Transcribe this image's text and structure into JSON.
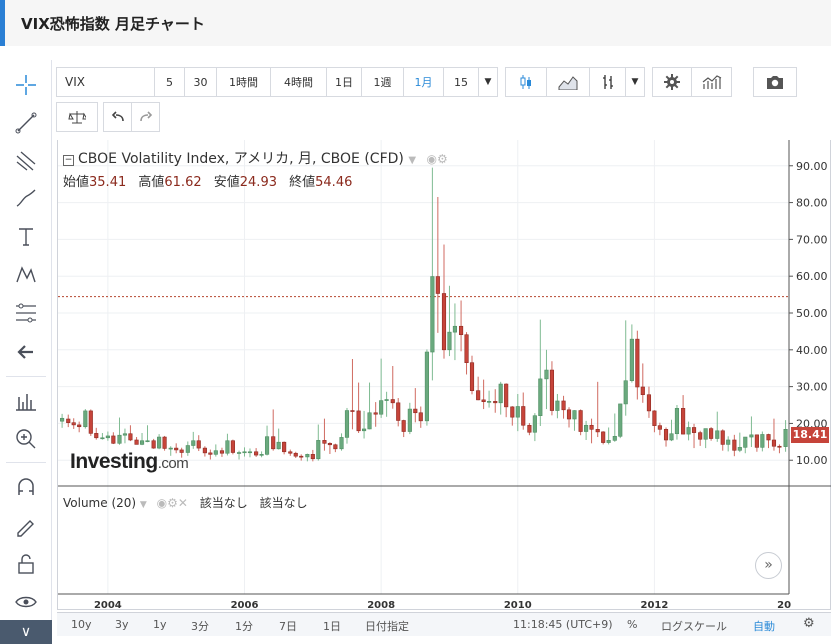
{
  "title": "VIX恐怖指数 月足チャート",
  "toolbar": {
    "symbol": "VIX",
    "intervals": [
      "5",
      "30",
      "1時間",
      "4時間",
      "1日",
      "1週",
      "1月",
      "15"
    ],
    "active_interval": "1月"
  },
  "legend": {
    "name": "CBOE Volatility Index, アメリカ, 月, CBOE (CFD)",
    "open_label": "始値",
    "open": "35.41",
    "high_label": "高値",
    "high": "61.62",
    "low_label": "安値",
    "low": "24.93",
    "close_label": "終値",
    "close": "54.46"
  },
  "watermark": {
    "brand": "Investing",
    "suffix": ".com"
  },
  "volume": {
    "label": "Volume (20)",
    "na1": "該当なし",
    "na2": "該当なし"
  },
  "last_price": "18.41",
  "bottom_bar": {
    "ranges": [
      "10y",
      "3y",
      "1y",
      "3分",
      "1分",
      "7日",
      "1日",
      "日付指定"
    ],
    "time": "11:18:45 (UTC+9)",
    "percent": "%",
    "log": "ログスケール",
    "auto": "自動"
  },
  "colors": {
    "up": "#6aa97e",
    "down": "#c6443a",
    "accent": "#2a8ad8"
  },
  "chart_data": {
    "type": "candlestick",
    "y_ticks": [
      "10.00",
      "20.00",
      "30.00",
      "40.00",
      "50.00",
      "60.00",
      "70.00",
      "80.00",
      "90.00"
    ],
    "x_ticks": [
      "2004",
      "2006",
      "2008",
      "2010",
      "2012",
      "20"
    ],
    "ylim": [
      3,
      97
    ],
    "xlim": [
      2003.27,
      2013.97
    ],
    "hline": 54.46,
    "grid": true,
    "candles": [
      {
        "x": 2003.33,
        "o": 20.6,
        "h": 22.6,
        "l": 18.8,
        "c": 21.4
      },
      {
        "x": 2003.42,
        "o": 21.2,
        "h": 22.4,
        "l": 19.0,
        "c": 20.2
      },
      {
        "x": 2003.5,
        "o": 20.2,
        "h": 21.4,
        "l": 18.5,
        "c": 19.6
      },
      {
        "x": 2003.58,
        "o": 19.6,
        "h": 20.5,
        "l": 17.6,
        "c": 19.1
      },
      {
        "x": 2003.67,
        "o": 19.1,
        "h": 23.9,
        "l": 18.6,
        "c": 23.4
      },
      {
        "x": 2003.75,
        "o": 23.4,
        "h": 23.8,
        "l": 16.6,
        "c": 17.3
      },
      {
        "x": 2003.83,
        "o": 17.3,
        "h": 18.8,
        "l": 15.6,
        "c": 16.1
      },
      {
        "x": 2003.92,
        "o": 16.1,
        "h": 17.4,
        "l": 15.6,
        "c": 16.1
      },
      {
        "x": 2004.0,
        "o": 16.1,
        "h": 17.8,
        "l": 15.3,
        "c": 16.6
      },
      {
        "x": 2004.08,
        "o": 16.6,
        "h": 17.6,
        "l": 14.4,
        "c": 14.6
      },
      {
        "x": 2004.17,
        "o": 14.6,
        "h": 21.6,
        "l": 14.2,
        "c": 16.8
      },
      {
        "x": 2004.25,
        "o": 16.8,
        "h": 18.6,
        "l": 14.6,
        "c": 17.2
      },
      {
        "x": 2004.33,
        "o": 17.2,
        "h": 19.5,
        "l": 15.2,
        "c": 15.5
      },
      {
        "x": 2004.42,
        "o": 15.5,
        "h": 16.3,
        "l": 14.3,
        "c": 14.3
      },
      {
        "x": 2004.5,
        "o": 14.3,
        "h": 17.4,
        "l": 14.1,
        "c": 15.3
      },
      {
        "x": 2004.58,
        "o": 15.3,
        "h": 19.5,
        "l": 14.9,
        "c": 15.3
      },
      {
        "x": 2004.67,
        "o": 15.3,
        "h": 15.8,
        "l": 13.1,
        "c": 13.3
      },
      {
        "x": 2004.75,
        "o": 13.3,
        "h": 17.1,
        "l": 13.0,
        "c": 16.3
      },
      {
        "x": 2004.83,
        "o": 16.3,
        "h": 16.6,
        "l": 12.6,
        "c": 13.2
      },
      {
        "x": 2004.92,
        "o": 13.2,
        "h": 13.8,
        "l": 11.2,
        "c": 13.3
      },
      {
        "x": 2005.0,
        "o": 13.3,
        "h": 14.6,
        "l": 11.9,
        "c": 12.8
      },
      {
        "x": 2005.08,
        "o": 12.8,
        "h": 13.4,
        "l": 10.7,
        "c": 12.1
      },
      {
        "x": 2005.17,
        "o": 12.1,
        "h": 15.1,
        "l": 11.2,
        "c": 14.0
      },
      {
        "x": 2005.25,
        "o": 14.0,
        "h": 17.7,
        "l": 13.1,
        "c": 15.3
      },
      {
        "x": 2005.33,
        "o": 15.3,
        "h": 16.8,
        "l": 12.5,
        "c": 13.3
      },
      {
        "x": 2005.42,
        "o": 13.3,
        "h": 13.8,
        "l": 11.0,
        "c": 12.0
      },
      {
        "x": 2005.5,
        "o": 12.0,
        "h": 12.9,
        "l": 10.2,
        "c": 11.6
      },
      {
        "x": 2005.58,
        "o": 11.6,
        "h": 14.3,
        "l": 11.0,
        "c": 12.6
      },
      {
        "x": 2005.67,
        "o": 12.6,
        "h": 13.4,
        "l": 10.9,
        "c": 11.9
      },
      {
        "x": 2005.75,
        "o": 11.9,
        "h": 17.2,
        "l": 11.3,
        "c": 15.3
      },
      {
        "x": 2005.83,
        "o": 15.3,
        "h": 15.6,
        "l": 11.6,
        "c": 12.1
      },
      {
        "x": 2005.92,
        "o": 12.1,
        "h": 12.6,
        "l": 10.2,
        "c": 12.1
      },
      {
        "x": 2006.0,
        "o": 12.1,
        "h": 13.5,
        "l": 11.0,
        "c": 12.3
      },
      {
        "x": 2006.08,
        "o": 12.3,
        "h": 13.2,
        "l": 10.8,
        "c": 12.3
      },
      {
        "x": 2006.17,
        "o": 12.3,
        "h": 13.3,
        "l": 10.9,
        "c": 11.4
      },
      {
        "x": 2006.25,
        "o": 11.4,
        "h": 12.4,
        "l": 10.8,
        "c": 11.6
      },
      {
        "x": 2006.33,
        "o": 11.6,
        "h": 19.4,
        "l": 11.3,
        "c": 16.4
      },
      {
        "x": 2006.42,
        "o": 16.4,
        "h": 23.8,
        "l": 12.6,
        "c": 13.1
      },
      {
        "x": 2006.5,
        "o": 13.1,
        "h": 18.6,
        "l": 12.9,
        "c": 14.9
      },
      {
        "x": 2006.58,
        "o": 14.9,
        "h": 15.1,
        "l": 11.6,
        "c": 12.3
      },
      {
        "x": 2006.67,
        "o": 12.3,
        "h": 12.9,
        "l": 11.2,
        "c": 11.9
      },
      {
        "x": 2006.75,
        "o": 11.9,
        "h": 12.3,
        "l": 10.6,
        "c": 11.1
      },
      {
        "x": 2006.83,
        "o": 11.1,
        "h": 11.6,
        "l": 9.9,
        "c": 10.9
      },
      {
        "x": 2006.92,
        "o": 10.9,
        "h": 11.8,
        "l": 9.7,
        "c": 11.6
      },
      {
        "x": 2007.0,
        "o": 11.6,
        "h": 12.8,
        "l": 9.7,
        "c": 10.4
      },
      {
        "x": 2007.08,
        "o": 10.4,
        "h": 19.7,
        "l": 9.9,
        "c": 15.4
      },
      {
        "x": 2007.17,
        "o": 15.4,
        "h": 21.3,
        "l": 12.6,
        "c": 14.6
      },
      {
        "x": 2007.25,
        "o": 14.6,
        "h": 14.9,
        "l": 11.7,
        "c": 14.2
      },
      {
        "x": 2007.33,
        "o": 14.2,
        "h": 14.5,
        "l": 12.2,
        "c": 13.1
      },
      {
        "x": 2007.42,
        "o": 13.1,
        "h": 17.3,
        "l": 12.6,
        "c": 16.2
      },
      {
        "x": 2007.5,
        "o": 16.2,
        "h": 24.2,
        "l": 14.5,
        "c": 23.5
      },
      {
        "x": 2007.58,
        "o": 23.5,
        "h": 37.5,
        "l": 18.4,
        "c": 23.4
      },
      {
        "x": 2007.67,
        "o": 23.4,
        "h": 31.1,
        "l": 17.4,
        "c": 18.0
      },
      {
        "x": 2007.75,
        "o": 18.0,
        "h": 23.4,
        "l": 15.9,
        "c": 18.5
      },
      {
        "x": 2007.83,
        "o": 18.5,
        "h": 31.1,
        "l": 18.4,
        "c": 22.9
      },
      {
        "x": 2007.92,
        "o": 22.9,
        "h": 25.8,
        "l": 19.1,
        "c": 22.5
      },
      {
        "x": 2008.0,
        "o": 22.5,
        "h": 37.6,
        "l": 21.5,
        "c": 26.2
      },
      {
        "x": 2008.08,
        "o": 26.2,
        "h": 28.6,
        "l": 21.8,
        "c": 26.5
      },
      {
        "x": 2008.17,
        "o": 26.5,
        "h": 35.6,
        "l": 24.0,
        "c": 25.6
      },
      {
        "x": 2008.25,
        "o": 25.6,
        "h": 26.9,
        "l": 19.2,
        "c": 20.8
      },
      {
        "x": 2008.33,
        "o": 20.8,
        "h": 21.0,
        "l": 16.3,
        "c": 17.8
      },
      {
        "x": 2008.42,
        "o": 17.8,
        "h": 25.6,
        "l": 17.1,
        "c": 23.9
      },
      {
        "x": 2008.5,
        "o": 23.9,
        "h": 29.6,
        "l": 20.3,
        "c": 22.9
      },
      {
        "x": 2008.58,
        "o": 22.9,
        "h": 24.6,
        "l": 18.8,
        "c": 20.7
      },
      {
        "x": 2008.67,
        "o": 20.7,
        "h": 40.1,
        "l": 19.4,
        "c": 39.4
      },
      {
        "x": 2008.75,
        "o": 39.4,
        "h": 89.5,
        "l": 31.7,
        "c": 59.9
      },
      {
        "x": 2008.83,
        "o": 59.9,
        "h": 81.5,
        "l": 44.6,
        "c": 55.3
      },
      {
        "x": 2008.92,
        "o": 55.3,
        "h": 68.6,
        "l": 37.6,
        "c": 40.0
      },
      {
        "x": 2009.0,
        "o": 40.0,
        "h": 57.4,
        "l": 38.3,
        "c": 44.8
      },
      {
        "x": 2009.08,
        "o": 44.8,
        "h": 52.6,
        "l": 37.2,
        "c": 46.4
      },
      {
        "x": 2009.17,
        "o": 46.4,
        "h": 53.4,
        "l": 39.6,
        "c": 44.1
      },
      {
        "x": 2009.25,
        "o": 44.1,
        "h": 44.8,
        "l": 33.3,
        "c": 36.5
      },
      {
        "x": 2009.33,
        "o": 36.5,
        "h": 38.4,
        "l": 27.9,
        "c": 28.9
      },
      {
        "x": 2009.42,
        "o": 28.9,
        "h": 32.7,
        "l": 26.3,
        "c": 26.4
      },
      {
        "x": 2009.5,
        "o": 26.4,
        "h": 31.9,
        "l": 23.9,
        "c": 25.9
      },
      {
        "x": 2009.58,
        "o": 25.9,
        "h": 28.9,
        "l": 24.3,
        "c": 26.0
      },
      {
        "x": 2009.67,
        "o": 26.0,
        "h": 29.3,
        "l": 22.9,
        "c": 25.6
      },
      {
        "x": 2009.75,
        "o": 25.6,
        "h": 31.3,
        "l": 22.4,
        "c": 30.7
      },
      {
        "x": 2009.83,
        "o": 30.7,
        "h": 30.9,
        "l": 21.7,
        "c": 24.5
      },
      {
        "x": 2009.92,
        "o": 24.5,
        "h": 24.7,
        "l": 19.4,
        "c": 21.7
      },
      {
        "x": 2010.0,
        "o": 21.7,
        "h": 28.0,
        "l": 17.9,
        "c": 24.6
      },
      {
        "x": 2010.08,
        "o": 24.6,
        "h": 28.4,
        "l": 18.3,
        "c": 19.5
      },
      {
        "x": 2010.17,
        "o": 19.5,
        "h": 20.1,
        "l": 16.8,
        "c": 17.6
      },
      {
        "x": 2010.25,
        "o": 17.6,
        "h": 22.8,
        "l": 15.2,
        "c": 22.1
      },
      {
        "x": 2010.33,
        "o": 22.1,
        "h": 48.2,
        "l": 19.3,
        "c": 32.1
      },
      {
        "x": 2010.42,
        "o": 32.1,
        "h": 40.0,
        "l": 23.9,
        "c": 34.5
      },
      {
        "x": 2010.5,
        "o": 34.5,
        "h": 36.9,
        "l": 22.2,
        "c": 23.5
      },
      {
        "x": 2010.58,
        "o": 23.5,
        "h": 28.0,
        "l": 21.4,
        "c": 26.1
      },
      {
        "x": 2010.67,
        "o": 26.1,
        "h": 27.5,
        "l": 21.3,
        "c": 23.7
      },
      {
        "x": 2010.75,
        "o": 23.7,
        "h": 24.4,
        "l": 18.9,
        "c": 21.2
      },
      {
        "x": 2010.83,
        "o": 21.2,
        "h": 23.6,
        "l": 18.0,
        "c": 23.5
      },
      {
        "x": 2010.92,
        "o": 23.5,
        "h": 23.8,
        "l": 16.8,
        "c": 17.8
      },
      {
        "x": 2011.0,
        "o": 17.8,
        "h": 20.7,
        "l": 15.5,
        "c": 19.5
      },
      {
        "x": 2011.08,
        "o": 19.5,
        "h": 21.3,
        "l": 14.6,
        "c": 18.4
      },
      {
        "x": 2011.17,
        "o": 18.4,
        "h": 31.3,
        "l": 16.3,
        "c": 17.7
      },
      {
        "x": 2011.25,
        "o": 17.7,
        "h": 17.9,
        "l": 14.3,
        "c": 14.8
      },
      {
        "x": 2011.33,
        "o": 14.8,
        "h": 18.9,
        "l": 14.3,
        "c": 15.4
      },
      {
        "x": 2011.42,
        "o": 15.4,
        "h": 22.7,
        "l": 15.0,
        "c": 16.5
      },
      {
        "x": 2011.5,
        "o": 16.5,
        "h": 25.3,
        "l": 16.0,
        "c": 25.3
      },
      {
        "x": 2011.58,
        "o": 25.3,
        "h": 48.0,
        "l": 22.1,
        "c": 31.6
      },
      {
        "x": 2011.67,
        "o": 31.6,
        "h": 46.9,
        "l": 31.1,
        "c": 42.9
      },
      {
        "x": 2011.75,
        "o": 42.9,
        "h": 45.2,
        "l": 26.5,
        "c": 29.9
      },
      {
        "x": 2011.83,
        "o": 29.9,
        "h": 36.3,
        "l": 25.6,
        "c": 27.8
      },
      {
        "x": 2011.92,
        "o": 27.8,
        "h": 30.0,
        "l": 21.5,
        "c": 23.4
      },
      {
        "x": 2012.0,
        "o": 23.4,
        "h": 23.6,
        "l": 17.6,
        "c": 19.4
      },
      {
        "x": 2012.08,
        "o": 19.4,
        "h": 20.2,
        "l": 16.8,
        "c": 18.4
      },
      {
        "x": 2012.17,
        "o": 18.4,
        "h": 18.9,
        "l": 13.7,
        "c": 15.5
      },
      {
        "x": 2012.25,
        "o": 15.5,
        "h": 21.0,
        "l": 15.2,
        "c": 17.2
      },
      {
        "x": 2012.33,
        "o": 17.2,
        "h": 25.0,
        "l": 15.6,
        "c": 24.1
      },
      {
        "x": 2012.42,
        "o": 24.1,
        "h": 27.7,
        "l": 17.0,
        "c": 17.1
      },
      {
        "x": 2012.5,
        "o": 17.1,
        "h": 20.5,
        "l": 15.4,
        "c": 18.9
      },
      {
        "x": 2012.58,
        "o": 18.9,
        "h": 19.9,
        "l": 13.3,
        "c": 17.5
      },
      {
        "x": 2012.67,
        "o": 17.5,
        "h": 18.0,
        "l": 13.9,
        "c": 15.7
      },
      {
        "x": 2012.75,
        "o": 15.7,
        "h": 18.4,
        "l": 13.3,
        "c": 18.6
      },
      {
        "x": 2012.83,
        "o": 18.6,
        "h": 19.0,
        "l": 15.3,
        "c": 15.9
      },
      {
        "x": 2012.92,
        "o": 15.9,
        "h": 23.2,
        "l": 15.0,
        "c": 18.0
      },
      {
        "x": 2013.0,
        "o": 18.0,
        "h": 18.4,
        "l": 12.6,
        "c": 14.3
      },
      {
        "x": 2013.08,
        "o": 14.3,
        "h": 16.5,
        "l": 12.4,
        "c": 15.5
      },
      {
        "x": 2013.17,
        "o": 15.5,
        "h": 16.9,
        "l": 11.1,
        "c": 12.7
      },
      {
        "x": 2013.25,
        "o": 12.7,
        "h": 17.5,
        "l": 12.2,
        "c": 13.5
      },
      {
        "x": 2013.33,
        "o": 13.5,
        "h": 16.0,
        "l": 11.9,
        "c": 16.3
      },
      {
        "x": 2013.42,
        "o": 16.3,
        "h": 21.9,
        "l": 13.6,
        "c": 16.9
      },
      {
        "x": 2013.5,
        "o": 16.9,
        "h": 17.0,
        "l": 12.3,
        "c": 13.5
      },
      {
        "x": 2013.58,
        "o": 13.5,
        "h": 17.8,
        "l": 12.4,
        "c": 17.0
      },
      {
        "x": 2013.67,
        "o": 17.0,
        "h": 17.2,
        "l": 13.3,
        "c": 15.5
      },
      {
        "x": 2013.75,
        "o": 15.5,
        "h": 21.3,
        "l": 12.6,
        "c": 13.8
      },
      {
        "x": 2013.83,
        "o": 13.8,
        "h": 14.3,
        "l": 11.9,
        "c": 13.7
      },
      {
        "x": 2013.92,
        "o": 13.7,
        "h": 20.9,
        "l": 12.3,
        "c": 18.4
      }
    ]
  }
}
